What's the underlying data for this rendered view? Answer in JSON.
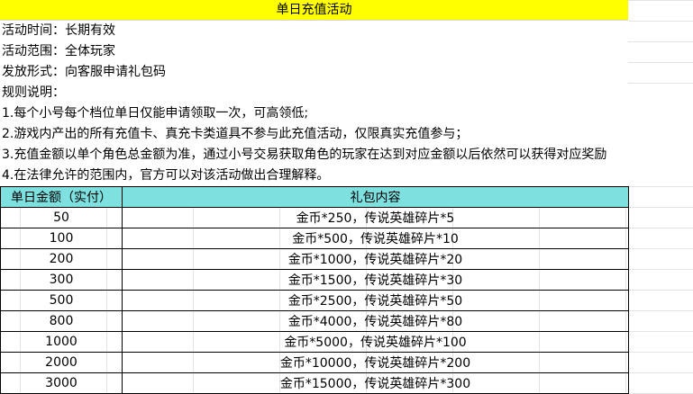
{
  "title": "单日充值活动",
  "info": [
    "活动时间：长期有效",
    "活动范围：全体玩家",
    "发放形式：向客服申请礼包码",
    "规则说明："
  ],
  "rules": [
    "1.每个小号每个档位单日仅能申请领取一次，可高领低;",
    "2.游戏内产出的所有充值卡、真充卡类道具不参与此充值活动，仅限真实充值参与；",
    "3.充值金额以单个角色总金额为准，通过小号交易获取角色的玩家在达到对应金额以后依然可以获得对应奖励",
    "4.在法律允许的范围内，官方可以对该活动做出合理解释。"
  ],
  "table": {
    "headers": [
      "单日金额（实付）",
      "礼包内容"
    ],
    "rows": [
      {
        "amount": "50",
        "reward": "金币*250，传说英雄碎片*5"
      },
      {
        "amount": "100",
        "reward": "金币*500，传说英雄碎片*10"
      },
      {
        "amount": "200",
        "reward": "金币*1000，传说英雄碎片*20"
      },
      {
        "amount": "300",
        "reward": "金币*1500，传说英雄碎片*30"
      },
      {
        "amount": "500",
        "reward": "金币*2500，传说英雄碎片*50"
      },
      {
        "amount": "800",
        "reward": "金币*4000，传说英雄碎片*80"
      },
      {
        "amount": "1000",
        "reward": "金币*5000，传说英雄碎片*100"
      },
      {
        "amount": "2000",
        "reward": "金币*10000，传说英雄碎片*200"
      },
      {
        "amount": "3000",
        "reward": "金币*15000，传说英雄碎片*300"
      }
    ]
  },
  "colors": {
    "title_bg": "#ffff00",
    "header_bg": "#7fe0e0"
  }
}
